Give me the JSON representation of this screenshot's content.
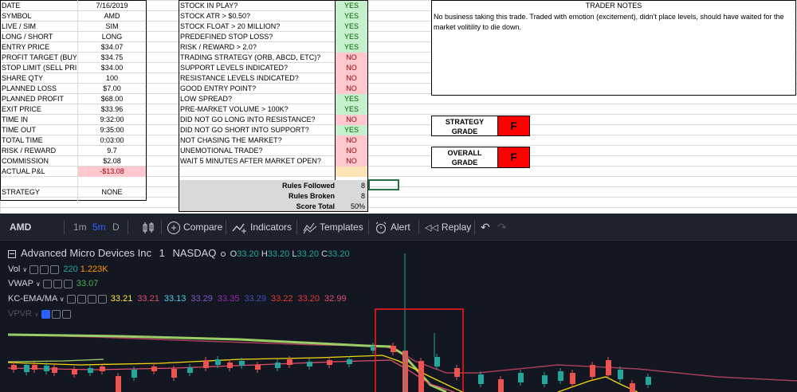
{
  "journal": {
    "rows": [
      {
        "label": "DATE",
        "value": "7/16/2019"
      },
      {
        "label": "SYMBOL",
        "value": "AMD"
      },
      {
        "label": "LIVE / SIM",
        "value": "SIM"
      },
      {
        "label": "LONG / SHORT",
        "value": "LONG"
      },
      {
        "label": "ENTRY PRICE",
        "value": "$34.07"
      },
      {
        "label": "PROFIT TARGET (BUY)",
        "value": "$34.75"
      },
      {
        "label": "STOP LIMIT (SELL PRICE)",
        "value": "$34.00"
      },
      {
        "label": "SHARE QTY",
        "value": "100"
      },
      {
        "label": "PLANNED LOSS",
        "value": "$7.00"
      },
      {
        "label": "PLANNED PROFIT",
        "value": "$68.00"
      },
      {
        "label": "EXIT PRICE",
        "value": "$33.96"
      },
      {
        "label": "TIME IN",
        "value": "9:32:00"
      },
      {
        "label": "TIME OUT",
        "value": "9:35:00"
      },
      {
        "label": "TOTAL TIME",
        "value": "0:03:00"
      },
      {
        "label": "RISK / REWARD",
        "value": "9.7"
      },
      {
        "label": "COMMISSION",
        "value": "$2.08"
      },
      {
        "label": "ACTUAL P&L",
        "value": "-$13.08"
      }
    ],
    "strategy_label": "STRATEGY",
    "strategy_value": "NONE"
  },
  "checklist": {
    "rules": [
      {
        "label": "STOCK IN PLAY?",
        "answer": "YES"
      },
      {
        "label": "STOCK ATR > $0.50?",
        "answer": "YES"
      },
      {
        "label": "STOCK FLOAT > 20 MILLION?",
        "answer": "YES"
      },
      {
        "label": "PREDEFINED STOP LOSS?",
        "answer": "YES"
      },
      {
        "label": "RISK / REWARD > 2.0?",
        "answer": "YES"
      },
      {
        "label": "TRADING STRATEGY (ORB, ABCD, ETC)?",
        "answer": "NO"
      },
      {
        "label": "SUPPORT LEVELS INDICATED?",
        "answer": "NO"
      },
      {
        "label": "RESISTANCE LEVELS INDICATED?",
        "answer": "NO"
      },
      {
        "label": "GOOD ENTRY POINT?",
        "answer": "NO"
      },
      {
        "label": "LOW SPREAD?",
        "answer": "YES"
      },
      {
        "label": "PRE-MARKET VOLUME > 100K?",
        "answer": "YES"
      },
      {
        "label": "DID NOT GO LONG INTO RESISTANCE?",
        "answer": "NO"
      },
      {
        "label": "DID NOT GO SHORT INTO SUPPORT?",
        "answer": "YES"
      },
      {
        "label": "NOT CHASING THE MARKET?",
        "answer": "NO"
      },
      {
        "label": "UNEMOTIONAL TRADE?",
        "answer": "NO"
      },
      {
        "label": "WAIT 5 MINUTES AFTER MARKET OPEN?",
        "answer": "NO"
      }
    ],
    "rules_followed_label": "Rules Followed",
    "rules_followed": "8",
    "rules_broken_label": "Rules Broken",
    "rules_broken": "8",
    "score_label": "Score Total",
    "score": "50%"
  },
  "notes": {
    "title": "TRADER NOTES",
    "text": "No business taking this trade. Traded with emotion (excitement), didn't place levels, should have waited for the market volitility to die down."
  },
  "grades": {
    "strategy_line1": "STRATEGY",
    "strategy_line2": "GRADE",
    "strategy_grade": "F",
    "overall_line1": "OVERALL",
    "overall_line2": "GRADE",
    "overall_grade": "F"
  },
  "chart": {
    "symbol": "AMD",
    "intervals": [
      "1m",
      "5m",
      "D"
    ],
    "compare": "Compare",
    "indicators": "Indicators",
    "templates": "Templates",
    "alert": "Alert",
    "replay": "Replay",
    "title": "Advanced Micro Devices Inc",
    "interval": "1",
    "exchange": "NASDAQ",
    "o_label": "O",
    "o": "33.20",
    "h_label": "H",
    "h": "33.20",
    "l_label": "L",
    "l": "33.20",
    "c_label": "C",
    "c": "33.20",
    "vol_label": "Vol",
    "vol_a": "220",
    "vol_b": "1.223K",
    "vwap_label": "VWAP",
    "vwap": "33.07",
    "kc_label": "KC-EMA/MA",
    "kc_values": [
      {
        "v": "33.21",
        "color": "#ffeb3b"
      },
      {
        "v": "33.21",
        "color": "#e04e6e"
      },
      {
        "v": "33.13",
        "color": "#4dd0e1"
      },
      {
        "v": "33.29",
        "color": "#7e57c2"
      },
      {
        "v": "33.35",
        "color": "#9c27b0"
      },
      {
        "v": "33.29",
        "color": "#3f51b5"
      },
      {
        "v": "33.22",
        "color": "#e53935"
      },
      {
        "v": "33.20",
        "color": "#e53935"
      },
      {
        "v": "32.99",
        "color": "#e04e6e"
      }
    ],
    "vpvr_label": "VPVR",
    "colors": {
      "up": "#26a69a",
      "down": "#ef5350",
      "bg": "#131722"
    }
  }
}
